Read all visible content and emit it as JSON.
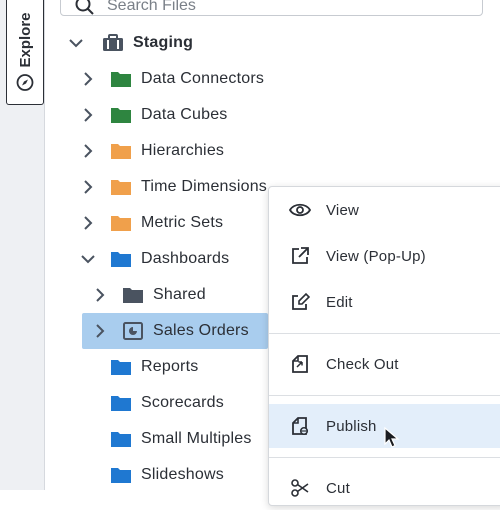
{
  "sidebar": {
    "explore_label": "Explore"
  },
  "search": {
    "placeholder": "Search Files"
  },
  "tree": {
    "root": {
      "label": "Staging"
    },
    "items": [
      {
        "label": "Data Connectors"
      },
      {
        "label": "Data Cubes"
      },
      {
        "label": "Hierarchies"
      },
      {
        "label": "Time Dimensions"
      },
      {
        "label": "Metric Sets"
      },
      {
        "label": "Dashboards"
      },
      {
        "label": "Shared"
      },
      {
        "label": "Sales Orders"
      },
      {
        "label": "Reports"
      },
      {
        "label": "Scorecards"
      },
      {
        "label": "Small Multiples"
      },
      {
        "label": "Slideshows"
      }
    ]
  },
  "context_menu": {
    "items": [
      {
        "label": "View",
        "icon": "eye-icon"
      },
      {
        "label": "View (Pop-Up)",
        "icon": "external-link-icon"
      },
      {
        "label": "Edit",
        "icon": "edit-icon"
      },
      {
        "label": "Check Out",
        "icon": "check-out-icon"
      },
      {
        "label": "Publish",
        "icon": "publish-icon"
      },
      {
        "label": "Cut",
        "icon": "scissors-icon"
      }
    ]
  },
  "colors": {
    "folder_green": "#2e8540",
    "folder_orange": "#f0a04b",
    "folder_blue": "#1f78d1",
    "folder_gray": "#4a5360",
    "selected": "#a9cdee",
    "menu_highlight": "#e3eefa"
  }
}
